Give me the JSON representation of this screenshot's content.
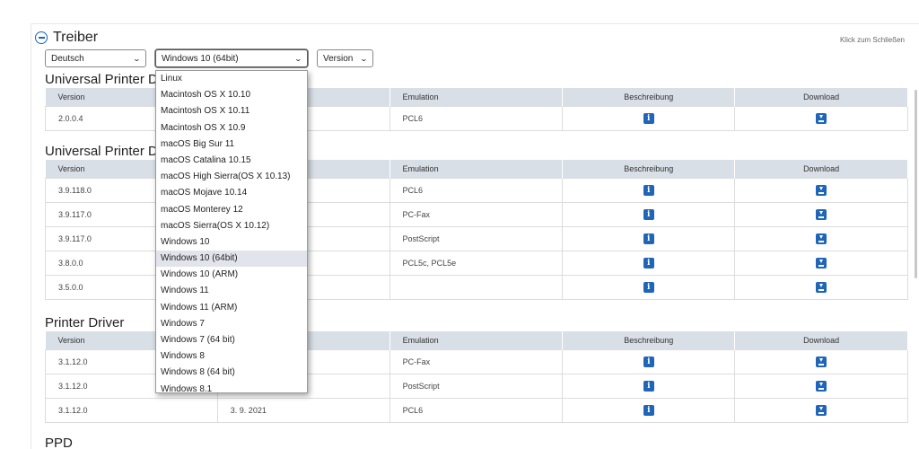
{
  "header": {
    "title": "Treiber",
    "close_hint": "Klick zum Schließen"
  },
  "filters": {
    "language": "Deutsch",
    "os": "Windows 10 (64bit)",
    "version": "Version"
  },
  "os_options": [
    "Linux",
    "Macintosh OS X 10.10",
    "Macintosh OS X 10.11",
    "Macintosh OS X 10.9",
    "macOS Big Sur 11",
    "macOS Catalina 10.15",
    "macOS High Sierra(OS X 10.13)",
    "macOS Mojave 10.14",
    "macOS Monterey 12",
    "macOS Sierra(OS X 10.12)",
    "Windows 10",
    "Windows 10 (64bit)",
    "Windows 10 (ARM)",
    "Windows 11",
    "Windows 11 (ARM)",
    "Windows 7",
    "Windows 7 (64 bit)",
    "Windows 8",
    "Windows 8 (64 bit)",
    "Windows 8.1"
  ],
  "selected_os_index": 11,
  "columns": {
    "version": "Version",
    "date": "",
    "emulation": "Emulation",
    "description": "Beschreibung",
    "download": "Download"
  },
  "sections": [
    {
      "title": "Universal Printer D",
      "rows": [
        {
          "version": "2.0.0.4",
          "date": "",
          "emulation": "PCL6"
        }
      ]
    },
    {
      "title": "Universal Printer D",
      "rows": [
        {
          "version": "3.9.118.0",
          "date": "",
          "emulation": "PCL6"
        },
        {
          "version": "3.9.117.0",
          "date": "",
          "emulation": "PC-Fax"
        },
        {
          "version": "3.9.117.0",
          "date": "",
          "emulation": "PostScript"
        },
        {
          "version": "3.8.0.0",
          "date": "",
          "emulation": "PCL5c, PCL5e"
        },
        {
          "version": "3.5.0.0",
          "date": "",
          "emulation": ""
        }
      ]
    },
    {
      "title": "Printer Driver",
      "rows": [
        {
          "version": "3.1.12.0",
          "date": "",
          "emulation": "PC-Fax"
        },
        {
          "version": "3.1.12.0",
          "date": "",
          "emulation": "PostScript"
        },
        {
          "version": "3.1.12.0",
          "date": "3. 9. 2021",
          "emulation": "PCL6"
        }
      ]
    },
    {
      "title": "PPD",
      "rows": []
    }
  ],
  "icons": {
    "collapse": "minus-circle-icon",
    "info": "info-icon",
    "download": "download-icon"
  },
  "colors": {
    "accent": "#1f65b8",
    "header_bg": "#d9dfe6"
  }
}
